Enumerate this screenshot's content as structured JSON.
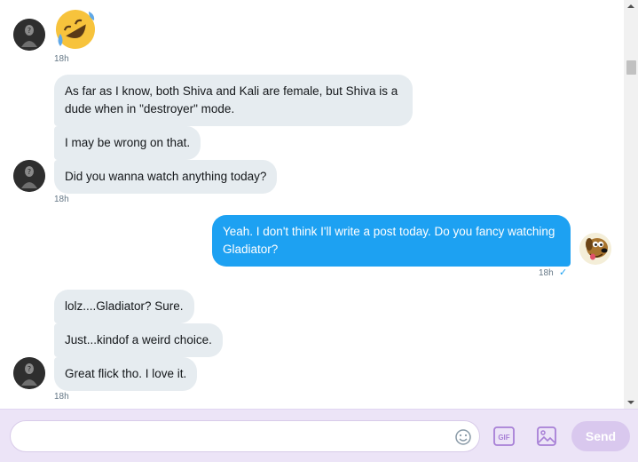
{
  "conversation": {
    "groups": [
      {
        "time": "18h"
      },
      {
        "messages": [
          {
            "text": "As far as I know, both Shiva and Kali are female, but Shiva is a dude when in \"destroyer\" mode."
          },
          {
            "text": "I may be wrong on that."
          },
          {
            "text": "Did you wanna watch anything today?"
          }
        ],
        "time": "18h"
      },
      {
        "messages": [
          {
            "text": "Yeah. I don't think I'll write a post today. Do you fancy watching Gladiator?"
          }
        ],
        "time": "18h",
        "status": "✓"
      },
      {
        "messages": [
          {
            "text": "lolz....Gladiator? Sure."
          },
          {
            "text": "Just...kindof a weird choice."
          },
          {
            "text": "Great flick tho. I love it."
          }
        ],
        "time": "18h"
      }
    ]
  },
  "composer": {
    "value": "",
    "placeholder": "",
    "send_label": "Send",
    "gif_label": "GIF"
  },
  "colors": {
    "incoming_bubble": "#e6ecf0",
    "outgoing_bubble": "#1da1f2",
    "composer_bg": "#ece4f7",
    "send_disabled": "#d9c8ee",
    "icon_accent": "#a77fd6"
  },
  "icons": {
    "emoji": "rolling-on-floor-laughing-emoji",
    "other_avatar": "user-avatar-icon",
    "my_avatar": "dog-avatar-icon",
    "emoji_picker": "smiley-icon",
    "gif": "gif-icon",
    "image": "image-icon",
    "read_receipt": "check-icon"
  }
}
